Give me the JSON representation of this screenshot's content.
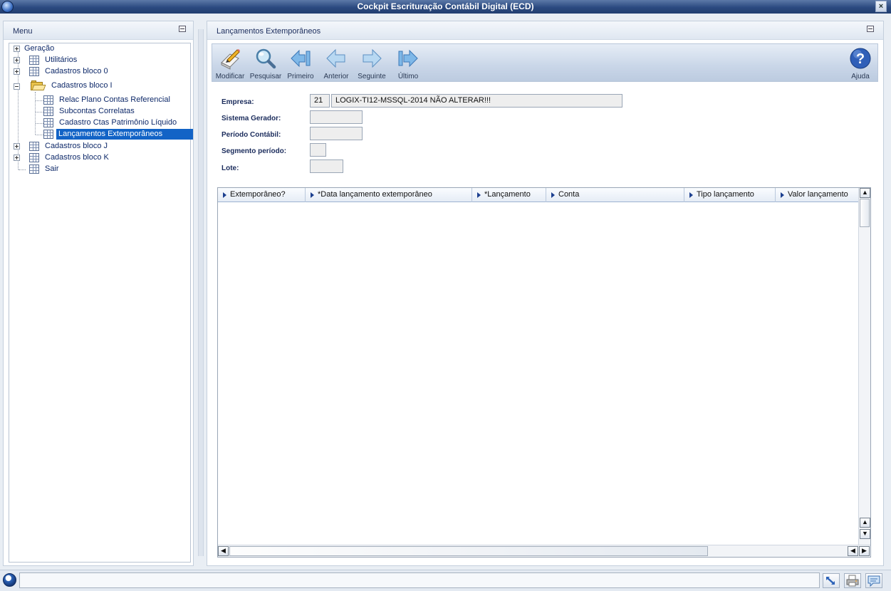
{
  "window": {
    "title": "Cockpit Escrituração Contábil Digital (ECD)",
    "close_label": "×"
  },
  "menu_panel": {
    "title": "Menu",
    "items": [
      {
        "label": "Geração",
        "icon": "plus-box-icon"
      },
      {
        "label": "Utilitários",
        "icon": "table-icon"
      },
      {
        "label": "Cadastros bloco 0",
        "icon": "table-icon"
      },
      {
        "label": "Cadastros bloco I",
        "icon": "folder-open-icon"
      },
      {
        "label": "Relac Plano Contas Referencial",
        "icon": "table-icon"
      },
      {
        "label": "Subcontas Correlatas",
        "icon": "table-icon"
      },
      {
        "label": "Cadastro Ctas Patrimônio Líquido",
        "icon": "table-icon"
      },
      {
        "label": "Lançamentos Extemporâneos",
        "icon": "table-icon",
        "selected": true
      },
      {
        "label": "Cadastros bloco J",
        "icon": "table-icon"
      },
      {
        "label": "Cadastros bloco K",
        "icon": "table-icon"
      },
      {
        "label": "Sair",
        "icon": "table-icon"
      }
    ]
  },
  "content_panel": {
    "title": "Lançamentos Extemporâneos",
    "toolbar": {
      "modificar": "Modificar",
      "pesquisar": "Pesquisar",
      "primeiro": "Primeiro",
      "anterior": "Anterior",
      "seguinte": "Seguinte",
      "ultimo": "Último",
      "ajuda": "Ajuda"
    },
    "form": {
      "empresa_label": "Empresa:",
      "empresa_code": "21",
      "empresa_name": "LOGIX-TI12-MSSQL-2014 NÃO ALTERAR!!!",
      "sistema_gerador_label": "Sistema Gerador:",
      "sistema_gerador_value": "",
      "periodo_contabil_label": "Período Contábil:",
      "periodo_contabil_value": "",
      "segmento_periodo_label": "Segmento período:",
      "segmento_periodo_value": "",
      "lote_label": "Lote:",
      "lote_value": ""
    },
    "grid": {
      "columns": [
        "Extemporâneo?",
        "*Data lançamento extemporâneo",
        "*Lançamento",
        "Conta",
        "Tipo lançamento",
        "Valor lançamento"
      ],
      "rows": []
    }
  },
  "colors": {
    "title_bar": "#2b4a80",
    "selection": "#1263c6",
    "accent": "#1c3f8f"
  }
}
